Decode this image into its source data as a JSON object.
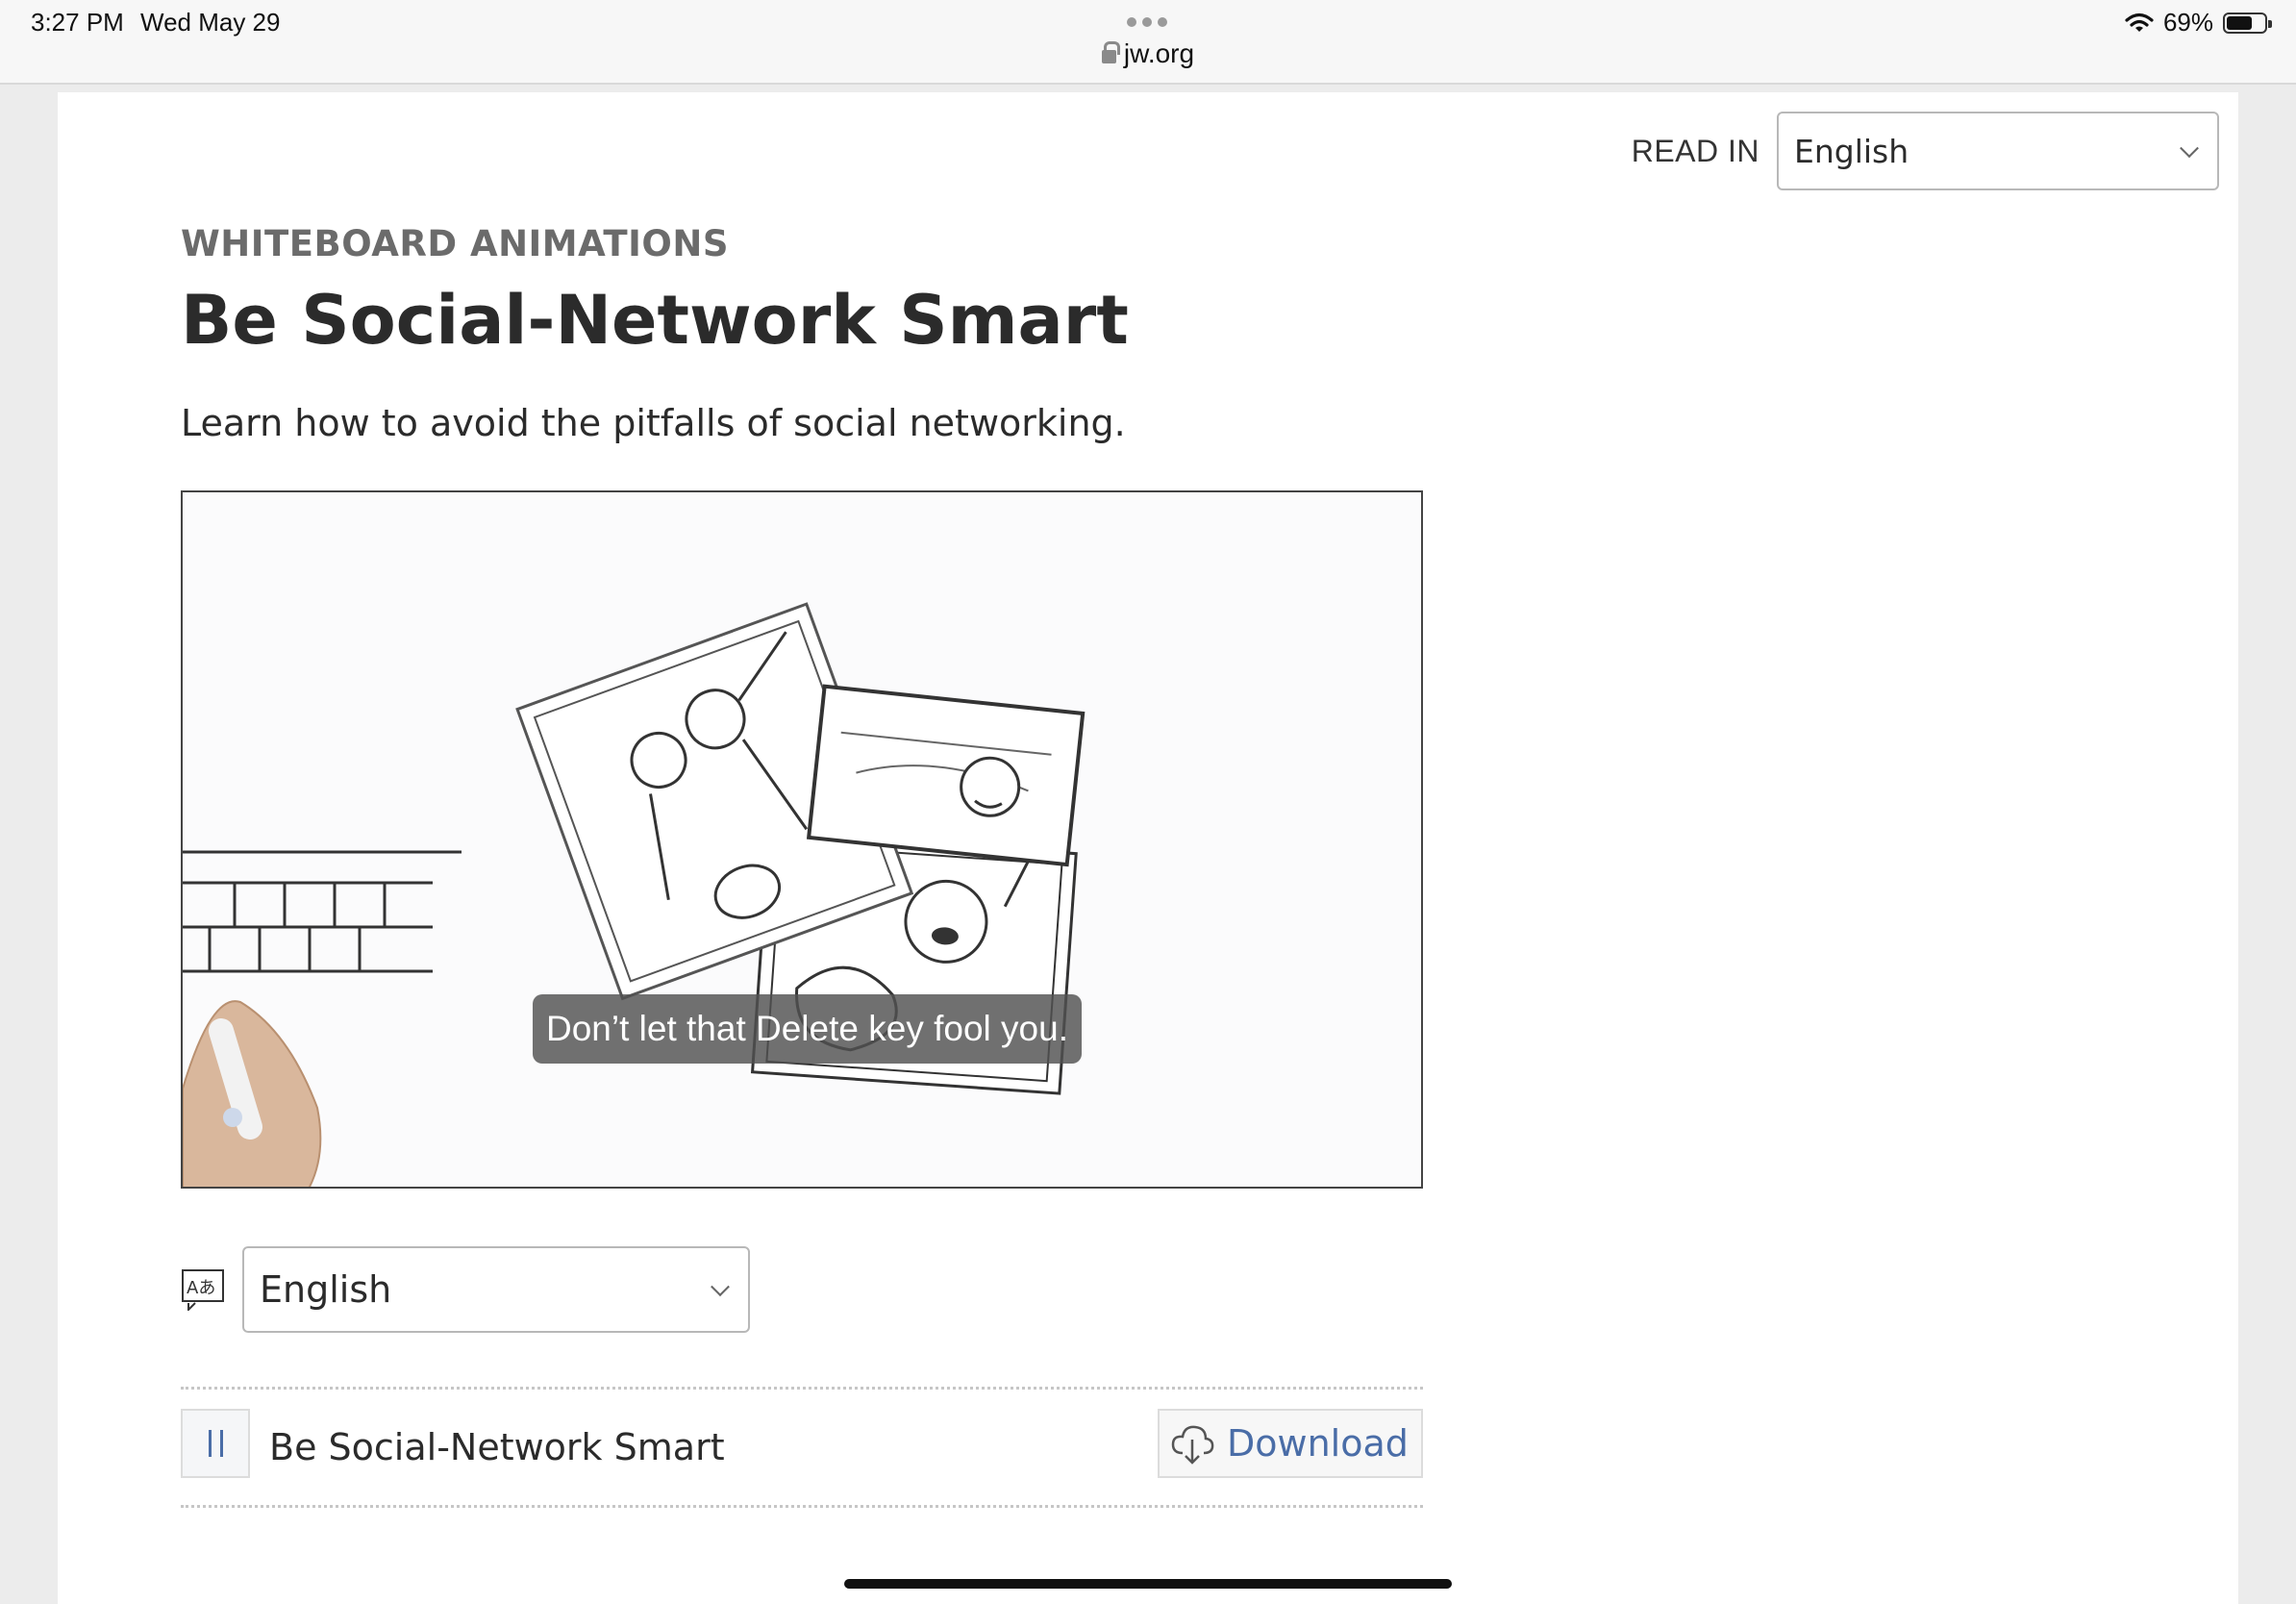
{
  "status_bar": {
    "time": "3:27 PM",
    "date": "Wed May 29",
    "url": "jw.org",
    "battery": "69%",
    "battery_level": 0.69
  },
  "read_in": {
    "label": "READ IN",
    "selected": "English"
  },
  "article": {
    "category": "WHITEBOARD ANIMATIONS",
    "title": "Be Social-Network Smart",
    "description": "Learn how to avoid the pitfalls of social networking."
  },
  "video": {
    "caption": "Don’t let that Delete key fool you."
  },
  "language_selector": {
    "selected": "English"
  },
  "media_item": {
    "title": "Be Social-Network Smart",
    "download_label": "Download"
  },
  "colors": {
    "link_blue": "#4a6da7",
    "text": "#2b2b2b",
    "category_gray": "#6b6b6b"
  }
}
